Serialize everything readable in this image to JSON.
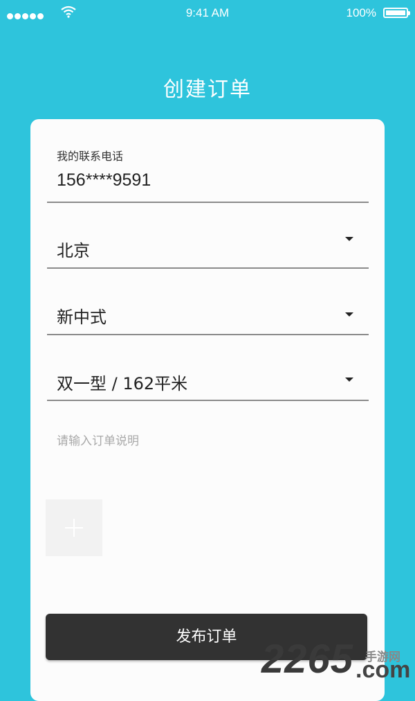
{
  "status_bar": {
    "time": "9:41 AM",
    "battery_percent": "100%",
    "signal_icon": "signal-dots-icon",
    "wifi_icon": "wifi-icon",
    "battery_icon": "battery-icon"
  },
  "header": {
    "title": "创建订单"
  },
  "form": {
    "phone_label": "我的联系电话",
    "phone_value": "156****9591",
    "city_value": "北京",
    "style_value": "新中式",
    "layout_value": "双一型 / 162平米",
    "note_placeholder": "请输入订单说明",
    "add_photo_icon": "plus-icon",
    "submit_label": "发布订单"
  },
  "watermark": {
    "number": "2265",
    "text": "手游网",
    "domain": ".com"
  },
  "colors": {
    "background": "#2ec4dc",
    "card": "#fcfcfc",
    "button": "#323232"
  }
}
